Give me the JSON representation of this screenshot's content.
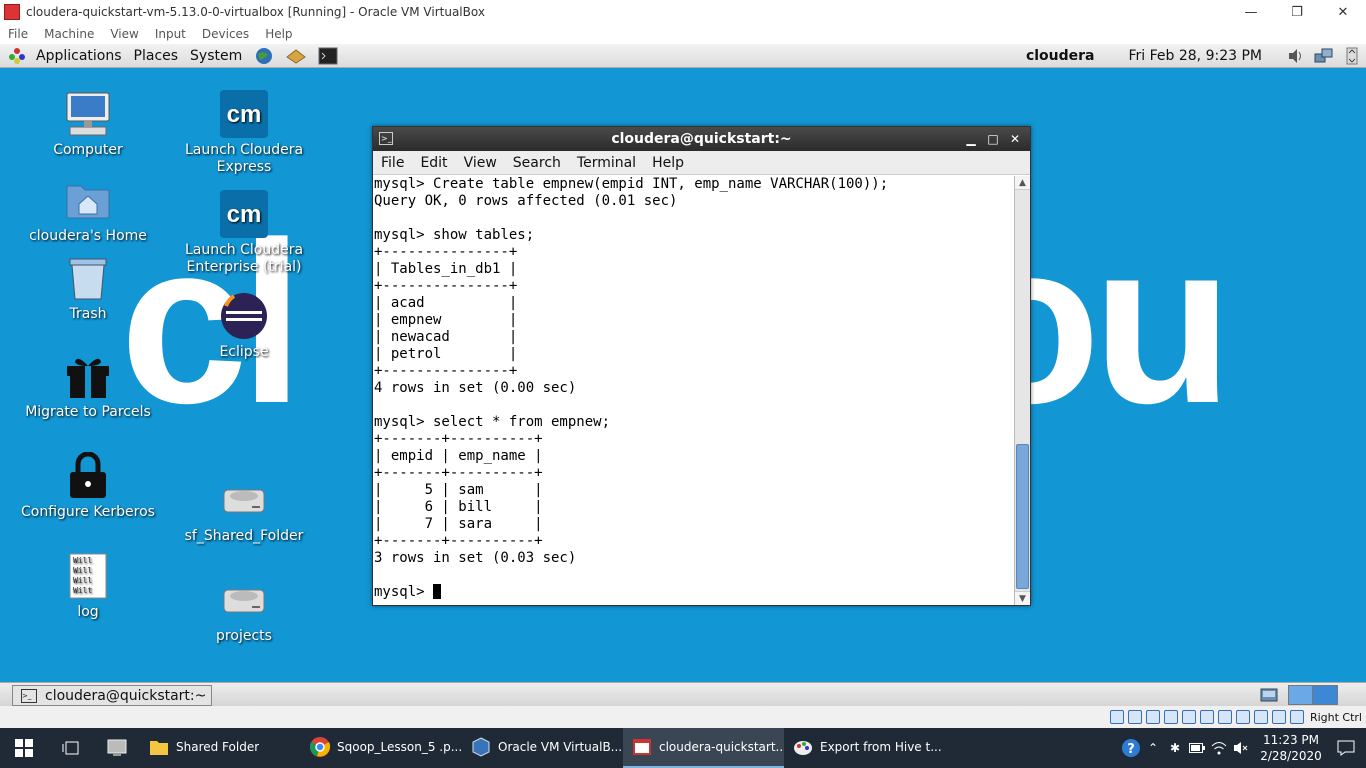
{
  "host_window": {
    "title": "cloudera-quickstart-vm-5.13.0-0-virtualbox [Running] - Oracle VM VirtualBox",
    "menu": [
      "File",
      "Machine",
      "View",
      "Input",
      "Devices",
      "Help"
    ],
    "controls": {
      "minimize": "—",
      "restore": "❐",
      "close": "✕"
    }
  },
  "guest_panel": {
    "menus": [
      "Applications",
      "Places",
      "System"
    ],
    "user": "cloudera",
    "clock": "Fri Feb 28,  9:23 PM"
  },
  "desktop": {
    "wallpaper_left": "cl",
    "wallpaper_right": "ou",
    "icons": [
      {
        "label": "Computer"
      },
      {
        "label": "Launch Cloudera Express"
      },
      {
        "label": "cloudera's Home"
      },
      {
        "label": "Launch Cloudera Enterprise (trial)"
      },
      {
        "label": "Trash"
      },
      {
        "label": "Eclipse"
      },
      {
        "label": "Migrate to Parcels"
      },
      {
        "label": "Configure Kerberos"
      },
      {
        "label": "sf_Shared_Folder"
      },
      {
        "label": "log"
      },
      {
        "label": "projects"
      }
    ],
    "cm_badge": "cm",
    "log_thumb": "Will\nWill\nWill\nWilt"
  },
  "terminal": {
    "title": "cloudera@quickstart:~",
    "menu": [
      "File",
      "Edit",
      "View",
      "Search",
      "Terminal",
      "Help"
    ],
    "lines": [
      "mysql> Create table empnew(empid INT, emp_name VARCHAR(100));",
      "Query OK, 0 rows affected (0.01 sec)",
      "",
      "mysql> show tables;",
      "+---------------+",
      "| Tables_in_db1 |",
      "+---------------+",
      "| acad          |",
      "| empnew        |",
      "| newacad       |",
      "| petrol        |",
      "+---------------+",
      "4 rows in set (0.00 sec)",
      "",
      "mysql> select * from empnew;",
      "+-------+----------+",
      "| empid | emp_name |",
      "+-------+----------+",
      "|     5 | sam      |",
      "|     6 | bill     |",
      "|     7 | sara     |",
      "+-------+----------+",
      "3 rows in set (0.03 sec)",
      "",
      "mysql> "
    ]
  },
  "guest_bottom": {
    "task_label": "cloudera@quickstart:~"
  },
  "vbox_status": {
    "host_key": "Right Ctrl"
  },
  "taskbar": {
    "apps": [
      {
        "label": "Shared Folder"
      },
      {
        "label": "Sqoop_Lesson_5 .p..."
      },
      {
        "label": "Oracle VM VirtualB..."
      },
      {
        "label": "cloudera-quickstart..."
      },
      {
        "label": "Export from Hive t..."
      }
    ],
    "time": "11:23 PM",
    "date": "2/28/2020"
  }
}
